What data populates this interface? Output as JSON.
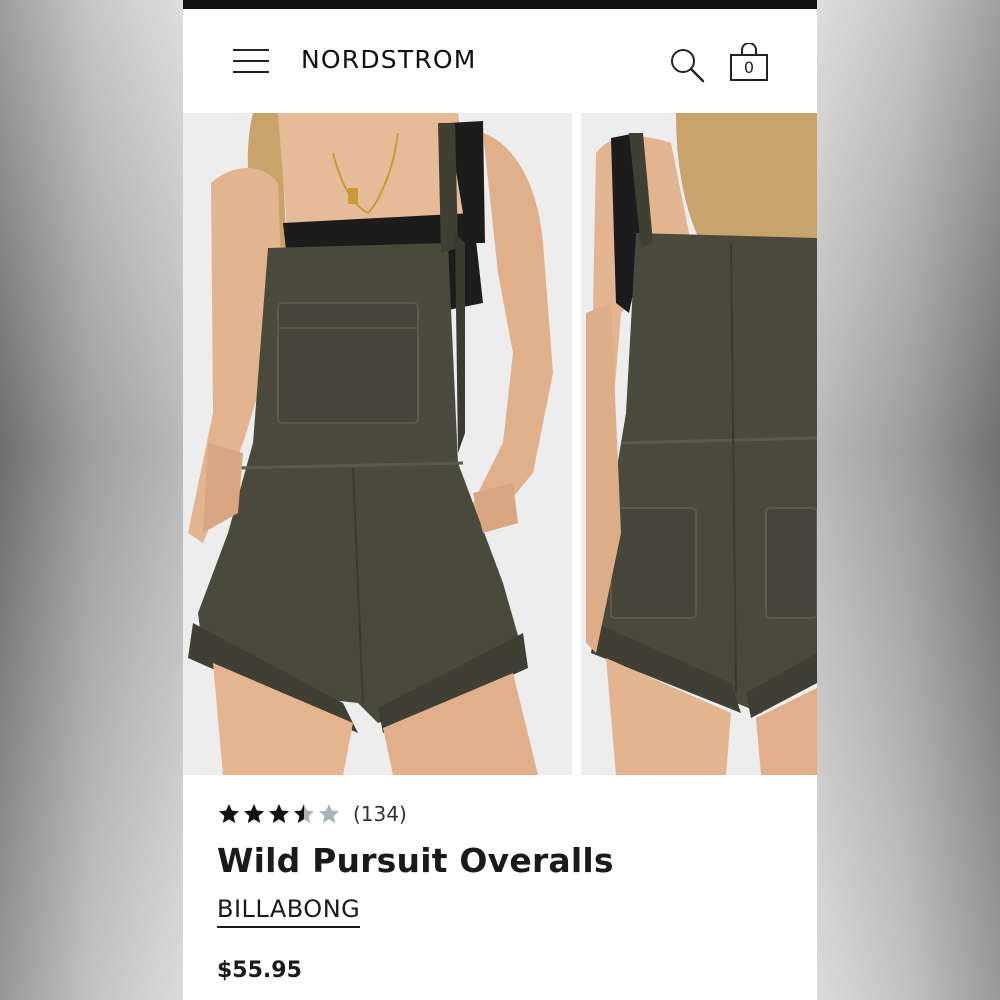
{
  "header": {
    "logo": "NORDSTROM",
    "bag_count": "0",
    "menu_icon": "hamburger-menu-icon",
    "search_icon": "search-icon",
    "bag_icon": "shopping-bag-icon"
  },
  "gallery": {
    "images": [
      {
        "view": "front",
        "subject": "woman wearing olive overall shorts"
      },
      {
        "view": "back",
        "subject": "back view of olive overall shorts"
      }
    ]
  },
  "product": {
    "rating": 3.5,
    "rating_max": 5,
    "review_count": "(134)",
    "title": "Wild Pursuit Overalls",
    "brand": "BILLABONG",
    "price": "$55.95"
  },
  "colors": {
    "star_filled": "#111111",
    "star_empty": "#a7b4bb",
    "garment": "#4a4a3c"
  }
}
